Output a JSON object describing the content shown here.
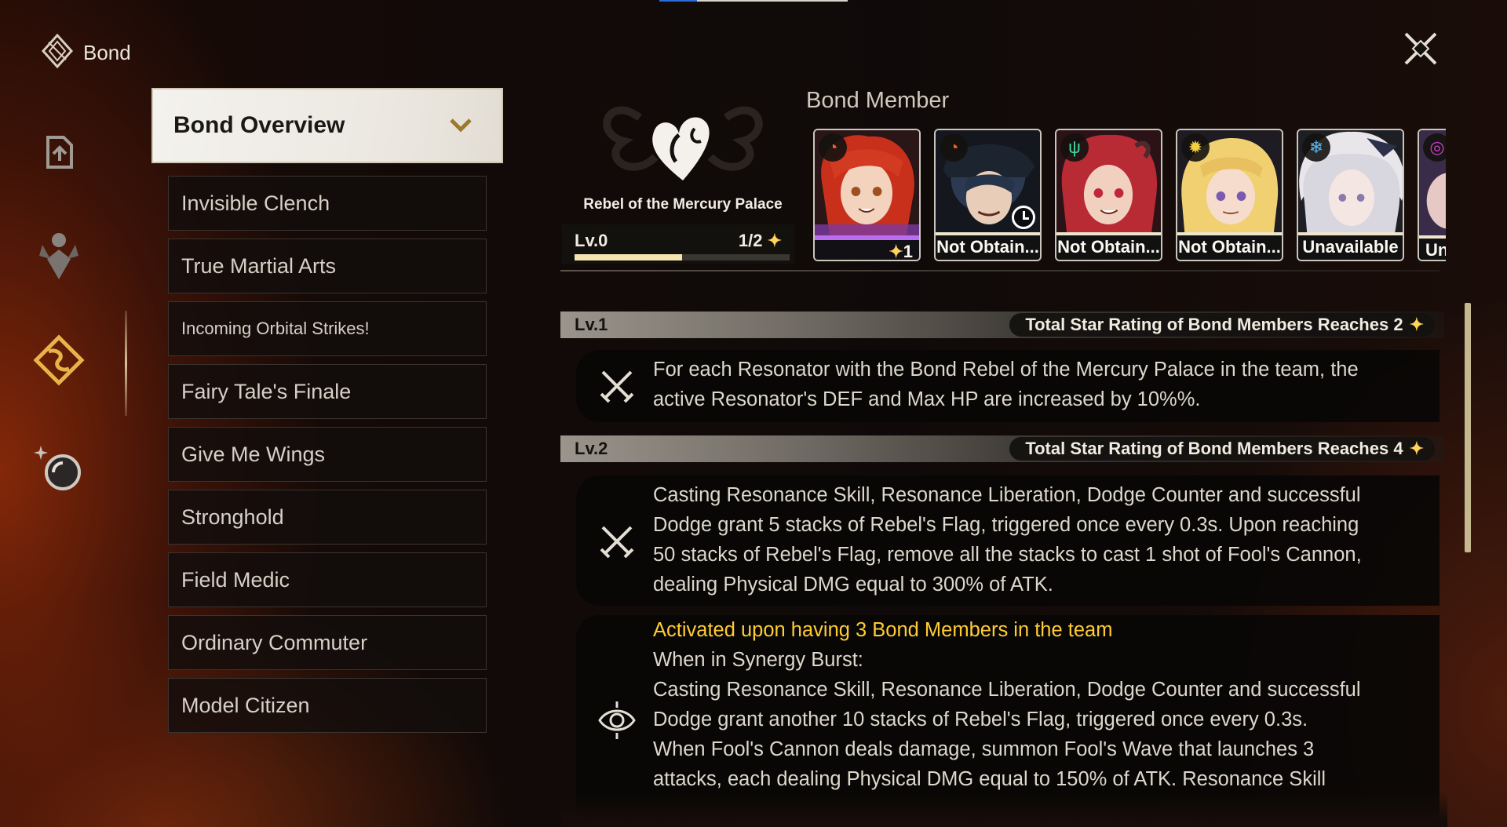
{
  "app": {
    "title": "Bond"
  },
  "colors": {
    "accent_gold": "#ffcc33",
    "owned_purple": "#b96ef0",
    "panel_bg": "#0f0a09"
  },
  "rail": [
    {
      "name": "rail-upload",
      "icon": "share-doc-icon"
    },
    {
      "name": "rail-character",
      "icon": "figure-icon"
    },
    {
      "name": "rail-bond",
      "icon": "bond-star-icon"
    },
    {
      "name": "rail-orb",
      "icon": "orb-icon"
    }
  ],
  "list": {
    "dropdown_label": "Bond Overview",
    "items": [
      "Invisible Clench",
      "True Martial Arts",
      "Incoming Orbital Strikes!",
      "Fairy Tale's Finale",
      "Give Me Wings",
      "Stronghold",
      "Field Medic",
      "Ordinary Commuter",
      "Model Citizen"
    ]
  },
  "bond": {
    "name": "Rebel of the Mercury Palace",
    "level": "Lv.0",
    "progress": "1/2",
    "progress_fraction": 0.5
  },
  "members": {
    "title": "Bond Member",
    "cards": [
      {
        "status": "1",
        "element": "fusion",
        "owned": true
      },
      {
        "status": "Not Obtain...",
        "element": "fusion",
        "owned": false,
        "timer": true
      },
      {
        "status": "Not Obtain...",
        "element": "aero",
        "owned": false
      },
      {
        "status": "Not Obtain...",
        "element": "spectro",
        "owned": false
      },
      {
        "status": "Unavailable",
        "element": "glacio",
        "owned": false
      },
      {
        "status": "Un",
        "element": "electro",
        "owned": false
      }
    ]
  },
  "effects": {
    "levels": [
      {
        "label": "Lv.1",
        "requirement": "Total Star Rating of Bond Members Reaches 2",
        "text": [
          "For each Resonator with the Bond Rebel of the Mercury Palace in the team, the",
          "active Resonator's DEF and Max HP are increased by 10%%."
        ]
      },
      {
        "label": "Lv.2",
        "requirement": "Total Star Rating of Bond Members Reaches 4",
        "text": [
          "Casting Resonance Skill, Resonance Liberation, Dodge Counter and successful",
          "Dodge grant 5 stacks of Rebel's Flag, triggered once every 0.3s. Upon reaching",
          "50 stacks of Rebel's Flag, remove all the stacks to cast 1 shot of Fool's Cannon,",
          "dealing Physical DMG equal to 300% of ATK."
        ]
      }
    ],
    "synergy": {
      "headline": "Activated upon having 3 Bond Members in the team",
      "text": [
        "When in Synergy Burst:",
        "Casting Resonance Skill, Resonance Liberation, Dodge Counter and successful",
        "Dodge grant another 10 stacks of Rebel's Flag, triggered once every 0.3s.",
        "When Fool's Cannon deals damage, summon Fool's Wave that launches 3",
        "attacks, each dealing Physical DMG equal to 150% of ATK. Resonance Skill"
      ]
    }
  }
}
